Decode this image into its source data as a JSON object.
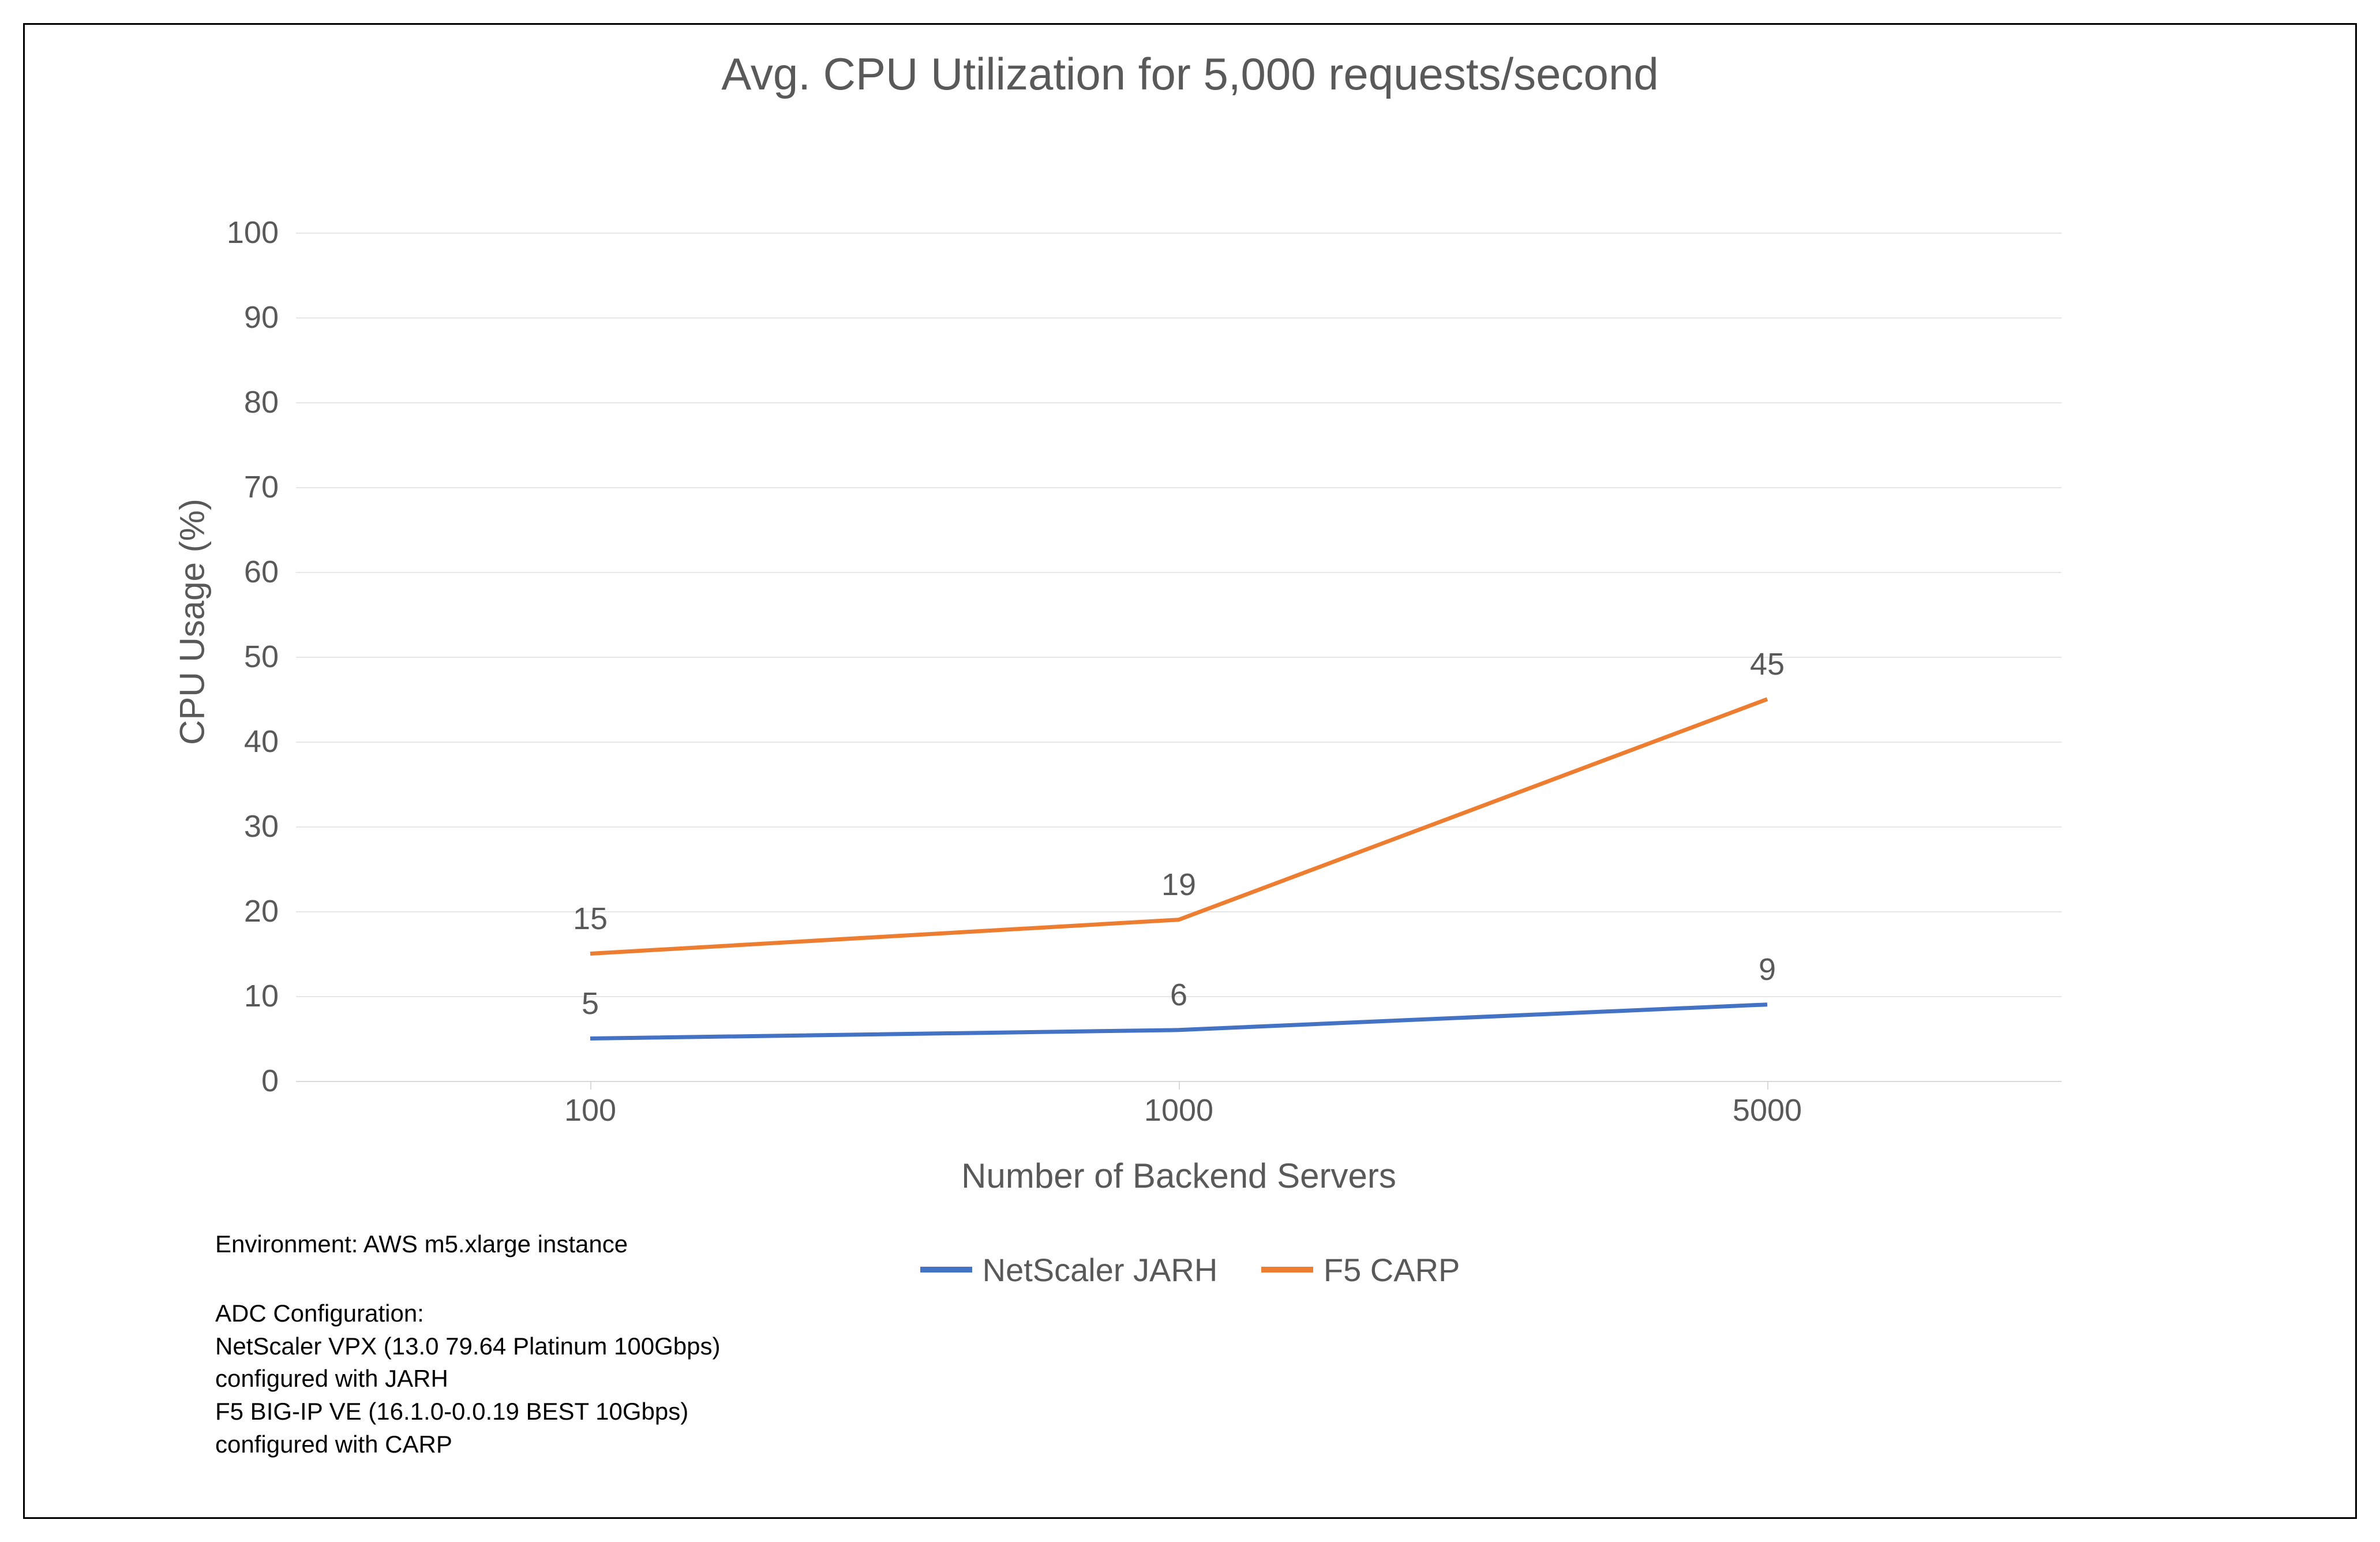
{
  "chart_data": {
    "type": "line",
    "title": "Avg. CPU Utilization for 5,000 requests/second",
    "xlabel": "Number of Backend Servers",
    "ylabel": "CPU Usage (%)",
    "categories": [
      "100",
      "1000",
      "5000"
    ],
    "ylim": [
      0,
      100
    ],
    "yticks": [
      0,
      10,
      20,
      30,
      40,
      50,
      60,
      70,
      80,
      90,
      100
    ],
    "series": [
      {
        "name": "NetScaler JARH",
        "color": "#4472C4",
        "values": [
          5,
          6,
          9
        ]
      },
      {
        "name": "F5 CARP",
        "color": "#ED7D31",
        "values": [
          15,
          19,
          45
        ]
      }
    ],
    "grid": true,
    "legend_position": "bottom"
  },
  "footnotes": {
    "env": "Environment: AWS m5.xlarge instance",
    "cfg_title": "ADC Configuration:",
    "cfg_line1a": "NetScaler VPX (13.0 79.64 Platinum 100Gbps)",
    "cfg_line1b": "configured with JARH",
    "cfg_line2a": "F5 BIG-IP VE (16.1.0-0.0.19 BEST 10Gbps)",
    "cfg_line2b": "configured with CARP"
  }
}
